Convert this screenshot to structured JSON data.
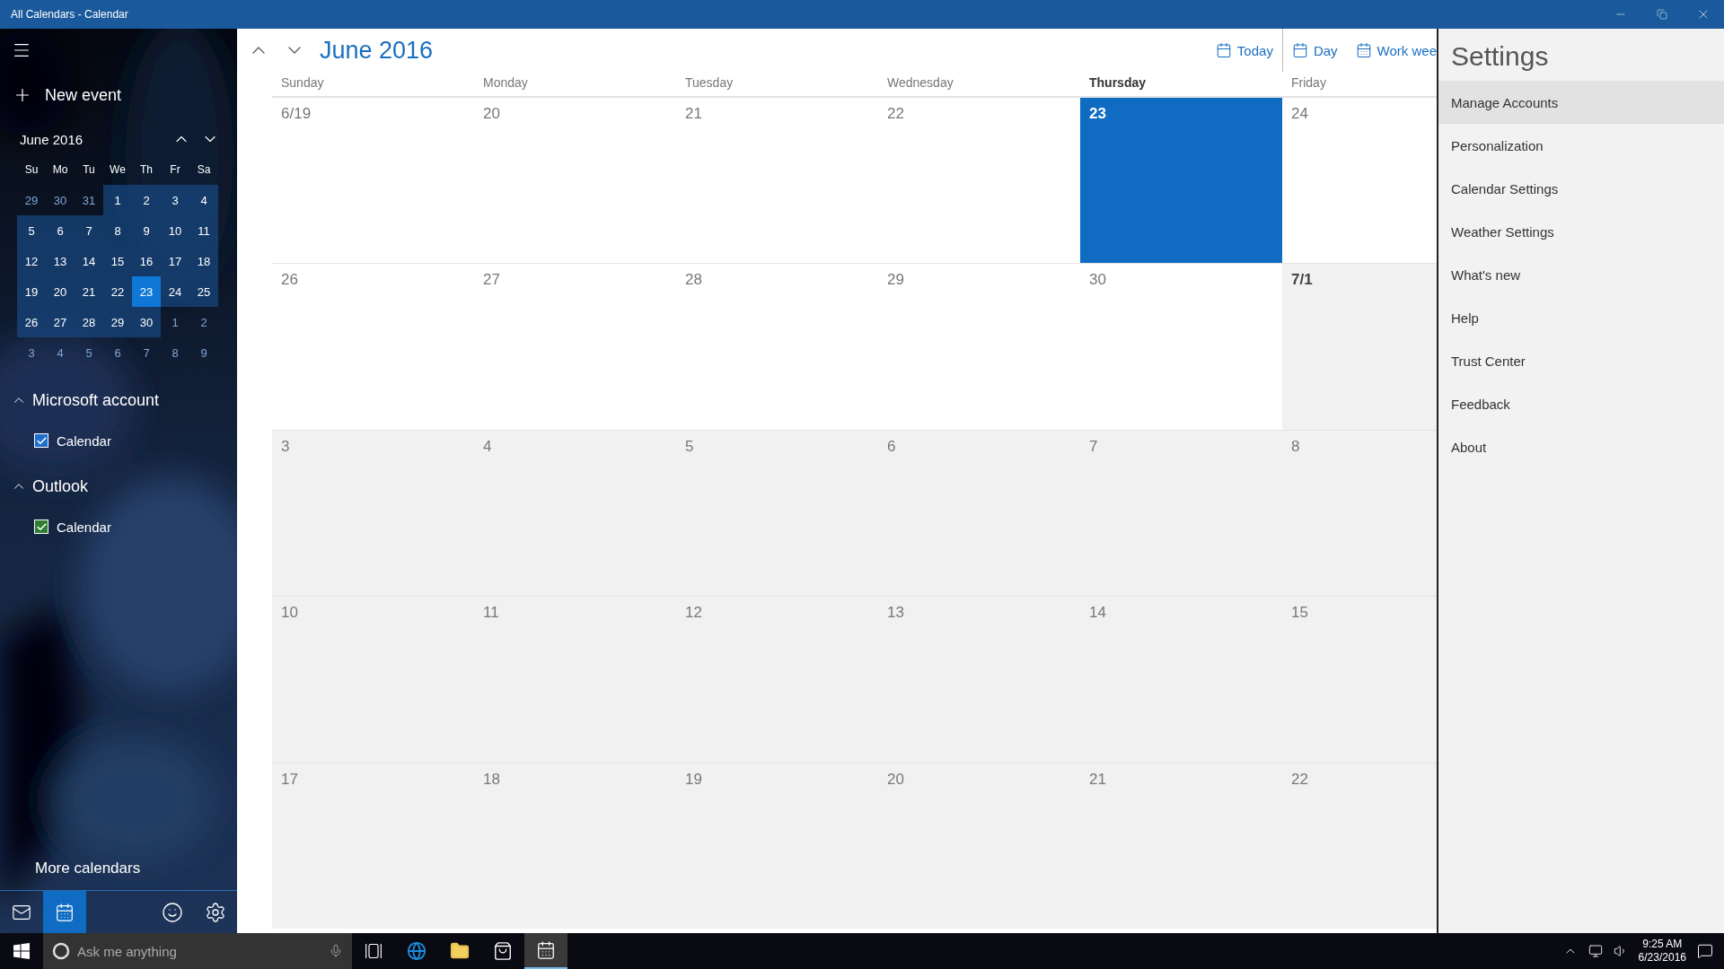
{
  "window": {
    "title": "All Calendars - Calendar"
  },
  "sidebar": {
    "new_event": "New event",
    "mini_calendar": {
      "title": "June 2016",
      "weekdays": [
        "Su",
        "Mo",
        "Tu",
        "We",
        "Th",
        "Fr",
        "Sa"
      ],
      "days": [
        {
          "label": "29",
          "in_month": false,
          "today": false
        },
        {
          "label": "30",
          "in_month": false,
          "today": false
        },
        {
          "label": "31",
          "in_month": false,
          "today": false
        },
        {
          "label": "1",
          "in_month": true,
          "today": false
        },
        {
          "label": "2",
          "in_month": true,
          "today": false
        },
        {
          "label": "3",
          "in_month": true,
          "today": false
        },
        {
          "label": "4",
          "in_month": true,
          "today": false
        },
        {
          "label": "5",
          "in_month": true,
          "today": false
        },
        {
          "label": "6",
          "in_month": true,
          "today": false
        },
        {
          "label": "7",
          "in_month": true,
          "today": false
        },
        {
          "label": "8",
          "in_month": true,
          "today": false
        },
        {
          "label": "9",
          "in_month": true,
          "today": false
        },
        {
          "label": "10",
          "in_month": true,
          "today": false
        },
        {
          "label": "11",
          "in_month": true,
          "today": false
        },
        {
          "label": "12",
          "in_month": true,
          "today": false
        },
        {
          "label": "13",
          "in_month": true,
          "today": false
        },
        {
          "label": "14",
          "in_month": true,
          "today": false
        },
        {
          "label": "15",
          "in_month": true,
          "today": false
        },
        {
          "label": "16",
          "in_month": true,
          "today": false
        },
        {
          "label": "17",
          "in_month": true,
          "today": false
        },
        {
          "label": "18",
          "in_month": true,
          "today": false
        },
        {
          "label": "19",
          "in_month": true,
          "today": false
        },
        {
          "label": "20",
          "in_month": true,
          "today": false
        },
        {
          "label": "21",
          "in_month": true,
          "today": false
        },
        {
          "label": "22",
          "in_month": true,
          "today": false
        },
        {
          "label": "23",
          "in_month": true,
          "today": true
        },
        {
          "label": "24",
          "in_month": true,
          "today": false
        },
        {
          "label": "25",
          "in_month": true,
          "today": false
        },
        {
          "label": "26",
          "in_month": true,
          "today": false
        },
        {
          "label": "27",
          "in_month": true,
          "today": false
        },
        {
          "label": "28",
          "in_month": true,
          "today": false
        },
        {
          "label": "29",
          "in_month": true,
          "today": false
        },
        {
          "label": "30",
          "in_month": true,
          "today": false
        },
        {
          "label": "1",
          "in_month": false,
          "today": false
        },
        {
          "label": "2",
          "in_month": false,
          "today": false
        },
        {
          "label": "3",
          "in_month": false,
          "today": false
        },
        {
          "label": "4",
          "in_month": false,
          "today": false
        },
        {
          "label": "5",
          "in_month": false,
          "today": false
        },
        {
          "label": "6",
          "in_month": false,
          "today": false
        },
        {
          "label": "7",
          "in_month": false,
          "today": false
        },
        {
          "label": "8",
          "in_month": false,
          "today": false
        },
        {
          "label": "9",
          "in_month": false,
          "today": false
        }
      ]
    },
    "accounts": [
      {
        "name": "Microsoft account",
        "expanded": true,
        "calendars": [
          {
            "label": "Calendar",
            "checked": true,
            "color": "#1e6fd0"
          }
        ]
      },
      {
        "name": "Outlook",
        "expanded": true,
        "calendars": [
          {
            "label": "Calendar",
            "checked": true,
            "color": "#2e7d32"
          }
        ]
      }
    ],
    "more_calendars": "More calendars",
    "nav": [
      {
        "kind": "mail",
        "selected": false
      },
      {
        "kind": "calendar",
        "selected": true
      },
      {
        "kind": "feedback",
        "selected": false
      },
      {
        "kind": "settings",
        "selected": false
      }
    ]
  },
  "header": {
    "title": "June 2016",
    "views": [
      {
        "kind": "today",
        "label": "Today"
      },
      {
        "kind": "day",
        "label": "Day"
      },
      {
        "kind": "workweek",
        "label": "Work wee"
      }
    ]
  },
  "calendar": {
    "weekdays": [
      {
        "label": "Sunday",
        "today": false
      },
      {
        "label": "Monday",
        "today": false
      },
      {
        "label": "Tuesday",
        "today": false
      },
      {
        "label": "Wednesday",
        "today": false
      },
      {
        "label": "Thursday",
        "today": true
      },
      {
        "label": "Friday",
        "today": false
      }
    ],
    "weeks": [
      [
        {
          "label": "6/19",
          "in_month": true,
          "today": false,
          "bold": false
        },
        {
          "label": "20",
          "in_month": true,
          "today": false,
          "bold": false
        },
        {
          "label": "21",
          "in_month": true,
          "today": false,
          "bold": false
        },
        {
          "label": "22",
          "in_month": true,
          "today": false,
          "bold": false
        },
        {
          "label": "23",
          "in_month": true,
          "today": true,
          "bold": true
        },
        {
          "label": "24",
          "in_month": true,
          "today": false,
          "bold": false
        }
      ],
      [
        {
          "label": "26",
          "in_month": true,
          "today": false,
          "bold": false
        },
        {
          "label": "27",
          "in_month": true,
          "today": false,
          "bold": false
        },
        {
          "label": "28",
          "in_month": true,
          "today": false,
          "bold": false
        },
        {
          "label": "29",
          "in_month": true,
          "today": false,
          "bold": false
        },
        {
          "label": "30",
          "in_month": true,
          "today": false,
          "bold": false
        },
        {
          "label": "7/1",
          "in_month": false,
          "today": false,
          "bold": true
        }
      ],
      [
        {
          "label": "3",
          "in_month": false,
          "today": false,
          "bold": false
        },
        {
          "label": "4",
          "in_month": false,
          "today": false,
          "bold": false
        },
        {
          "label": "5",
          "in_month": false,
          "today": false,
          "bold": false
        },
        {
          "label": "6",
          "in_month": false,
          "today": false,
          "bold": false
        },
        {
          "label": "7",
          "in_month": false,
          "today": false,
          "bold": false
        },
        {
          "label": "8",
          "in_month": false,
          "today": false,
          "bold": false
        }
      ],
      [
        {
          "label": "10",
          "in_month": false,
          "today": false,
          "bold": false
        },
        {
          "label": "11",
          "in_month": false,
          "today": false,
          "bold": false
        },
        {
          "label": "12",
          "in_month": false,
          "today": false,
          "bold": false
        },
        {
          "label": "13",
          "in_month": false,
          "today": false,
          "bold": false
        },
        {
          "label": "14",
          "in_month": false,
          "today": false,
          "bold": false
        },
        {
          "label": "15",
          "in_month": false,
          "today": false,
          "bold": false
        }
      ],
      [
        {
          "label": "17",
          "in_month": false,
          "today": false,
          "bold": false
        },
        {
          "label": "18",
          "in_month": false,
          "today": false,
          "bold": false
        },
        {
          "label": "19",
          "in_month": false,
          "today": false,
          "bold": false
        },
        {
          "label": "20",
          "in_month": false,
          "today": false,
          "bold": false
        },
        {
          "label": "21",
          "in_month": false,
          "today": false,
          "bold": false
        },
        {
          "label": "22",
          "in_month": false,
          "today": false,
          "bold": false
        }
      ]
    ]
  },
  "settings": {
    "title": "Settings",
    "items": [
      {
        "label": "Manage Accounts",
        "selected": true
      },
      {
        "label": "Personalization",
        "selected": false
      },
      {
        "label": "Calendar Settings",
        "selected": false
      },
      {
        "label": "Weather Settings",
        "selected": false
      },
      {
        "label": "What's new",
        "selected": false
      },
      {
        "label": "Help",
        "selected": false
      },
      {
        "label": "Trust Center",
        "selected": false
      },
      {
        "label": "Feedback",
        "selected": false
      },
      {
        "label": "About",
        "selected": false
      }
    ]
  },
  "taskbar": {
    "search_placeholder": "Ask me anything",
    "apps": [
      {
        "kind": "taskview",
        "active": false
      },
      {
        "kind": "browser",
        "active": false
      },
      {
        "kind": "folder",
        "active": false
      },
      {
        "kind": "store",
        "active": false
      },
      {
        "kind": "calendar",
        "active": true
      }
    ],
    "time": "9:25 AM",
    "date": "6/23/2016"
  }
}
